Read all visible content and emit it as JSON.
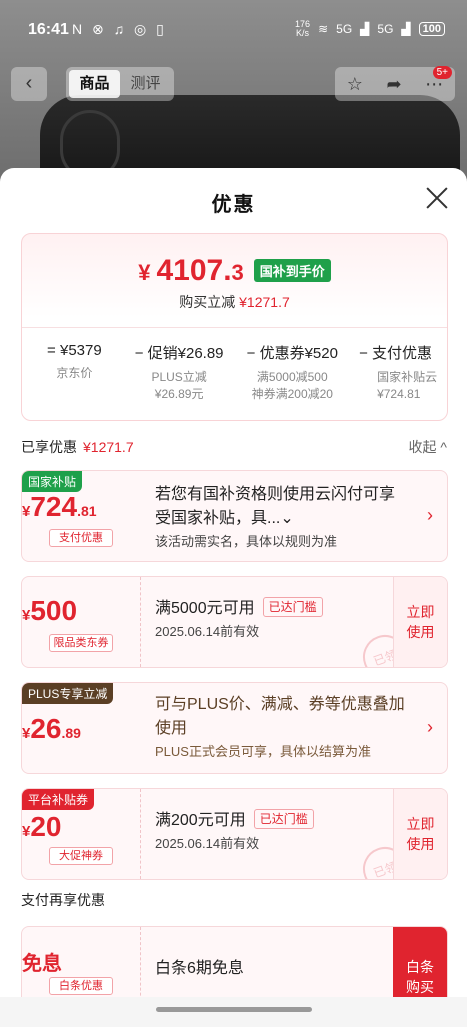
{
  "status_bar": {
    "time": "16:41",
    "left_icons": "N ⊗ ♫ ◎ ▯",
    "speed_top": "176",
    "speed_bottom": "K/s",
    "net1": "5G",
    "net2": "5G",
    "battery": "100"
  },
  "nav": {
    "tabs": [
      {
        "label": "商品"
      },
      {
        "label": "测评"
      }
    ],
    "badge": "5+"
  },
  "sheet": {
    "title": "优惠",
    "summary": {
      "price_symbol": "¥",
      "price_int": "4107.",
      "price_dec": "3",
      "price_tag": "国补到手价",
      "reduce_label": "购买立减",
      "reduce_value": "¥1271.7",
      "breakdown": [
        {
          "op": "=",
          "main": "¥5379",
          "sub1": "京东价",
          "sub2": ""
        },
        {
          "op": "−",
          "main": "促销¥26.89",
          "sub1": "PLUS立减",
          "sub2": "¥26.89元"
        },
        {
          "op": "−",
          "main": "优惠券¥520",
          "sub1": "满5000减500",
          "sub2": "神券满200减20"
        },
        {
          "op": "−",
          "main": "支付优惠",
          "sub1": "国家补贴云",
          "sub2": "¥724.81"
        }
      ]
    },
    "enjoyed": {
      "label": "已享优惠",
      "value": "¥1271.7",
      "collapse": "收起 ^"
    },
    "cards": [
      {
        "ribbon": "国家补贴",
        "sym": "¥",
        "int": "724",
        "dec": ".81",
        "label": "支付优惠",
        "title": "若您有国补资格则使用云闪付可享受国家补贴，具...⌄",
        "sub": "该活动需实名，具体以规则为准"
      },
      {
        "ribbon": "",
        "sym": "¥",
        "int": "500",
        "dec": "",
        "label": "限品类东券",
        "title": "满5000元可用",
        "reached": "已达门槛",
        "sub": "2025.06.14前有效",
        "action": "立即使用",
        "stamp": "已领"
      },
      {
        "ribbon": "PLUS专享立减",
        "sym": "¥",
        "int": "26",
        "dec": ".89",
        "label": "",
        "title": "可与PLUS价、满减、券等优惠叠加使用",
        "sub": "PLUS正式会员可享，具体以结算为准"
      },
      {
        "ribbon": "平台补贴券",
        "sym": "¥",
        "int": "20",
        "dec": "",
        "label": "大促神券",
        "title": "满200元可用",
        "reached": "已达门槛",
        "sub": "2025.06.14前有效",
        "action": "立即使用",
        "stamp": "已领"
      }
    ],
    "pay_title": "支付再享优惠",
    "bt": {
      "amount": "免息",
      "label": "白条优惠",
      "title": "白条6期免息",
      "action": "白条购买"
    }
  }
}
